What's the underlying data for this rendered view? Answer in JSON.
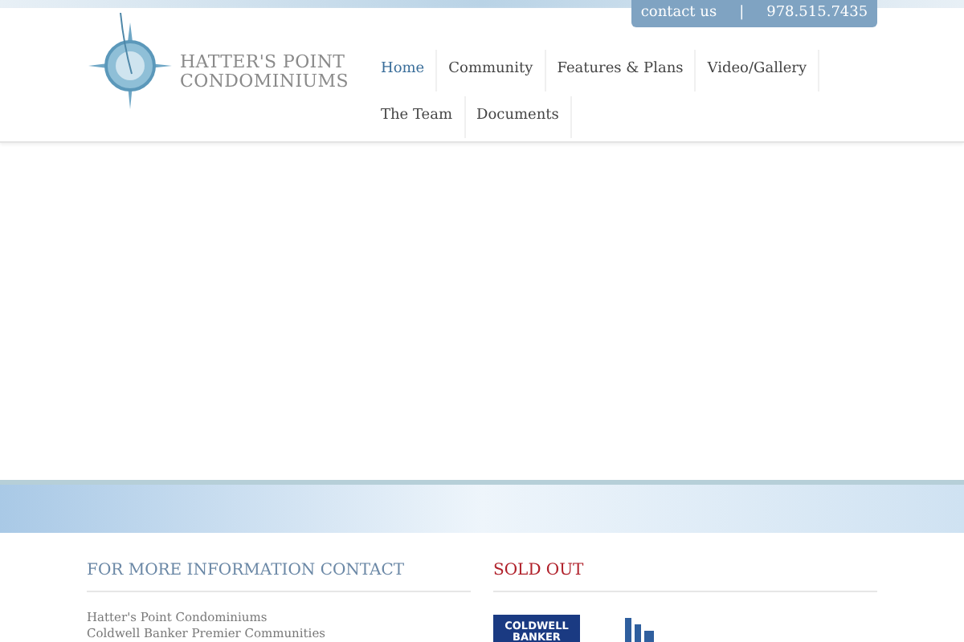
{
  "contact_bar": {
    "link": "contact us",
    "separator": "|",
    "phone": "978.515.7435"
  },
  "brand": {
    "line_1": "HATTER'S POINT",
    "line_2": "CONDOMINIUMS"
  },
  "nav": [
    {
      "label": "Home",
      "selected": true
    },
    {
      "label": "Community",
      "selected": false
    },
    {
      "label": "Features & Plans",
      "selected": false
    },
    {
      "label": "Video/Gallery",
      "selected": false
    },
    {
      "label": "The Team",
      "selected": false
    },
    {
      "label": "Documents",
      "selected": false
    }
  ],
  "footer": {
    "contact": {
      "heading": "FOR MORE INFORMATION CONTACT",
      "lines": [
        "Hatter's Point Condominiums",
        "Coldwell Banker Premier Communities"
      ]
    },
    "sold_out": {
      "heading": "SOLD OUT",
      "logo_text": [
        "COLDWELL",
        "BANKER"
      ]
    }
  }
}
